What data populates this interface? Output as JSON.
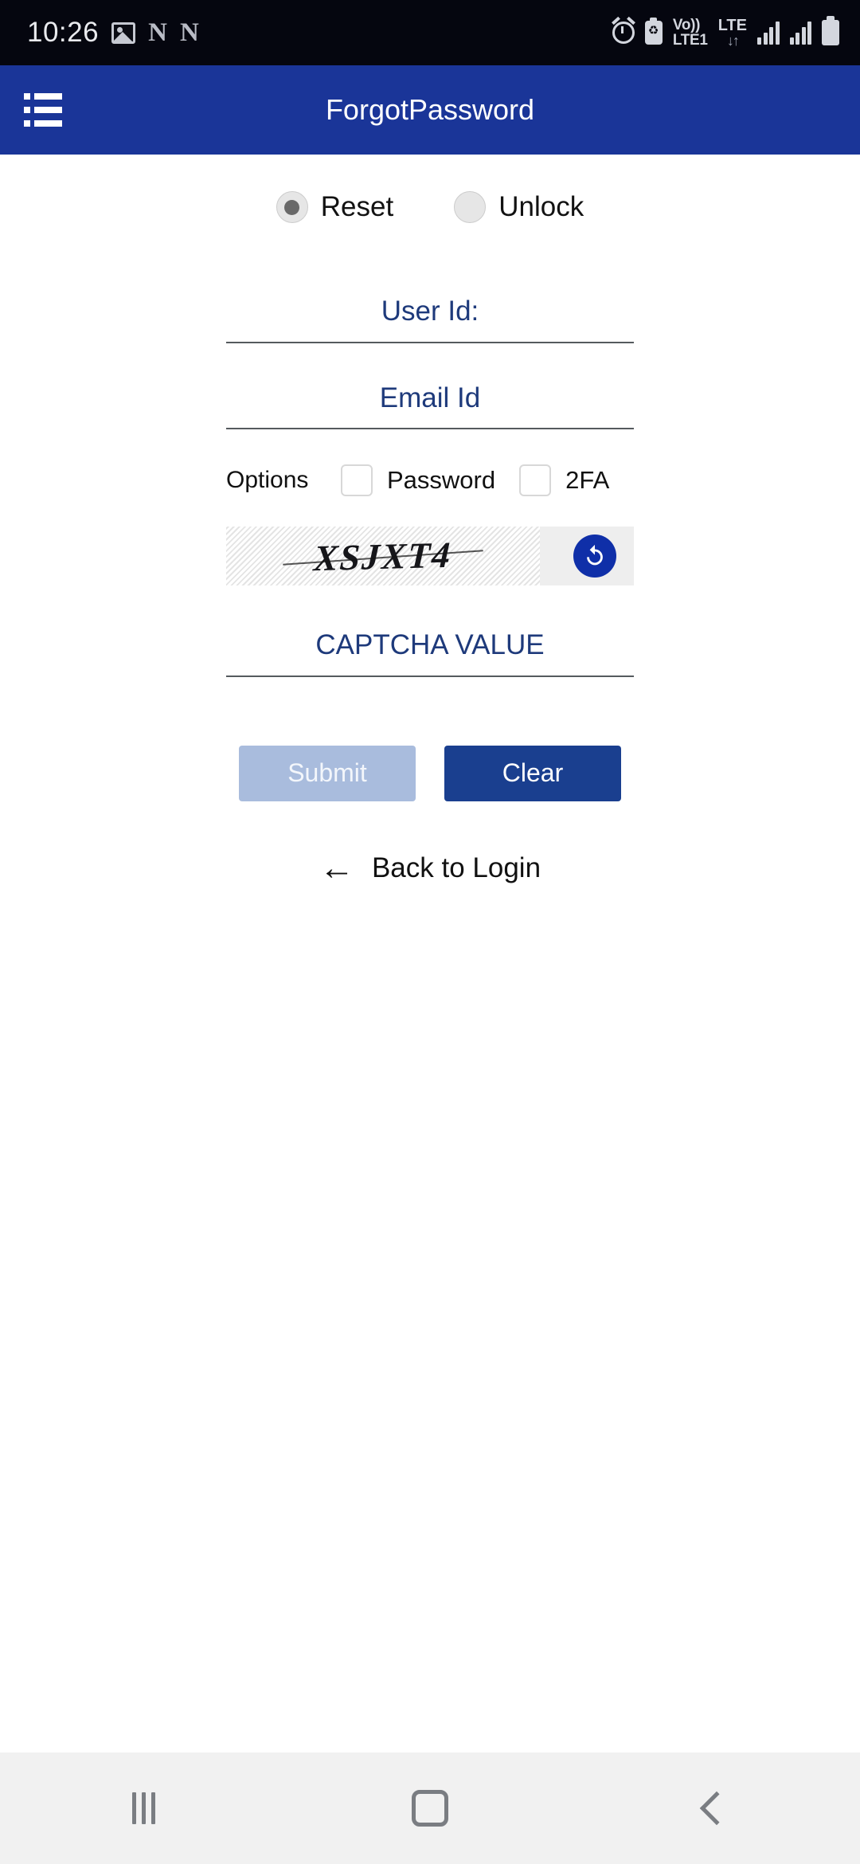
{
  "status_bar": {
    "time": "10:26",
    "left_icons": [
      {
        "name": "photo-icon",
        "glyph": "image"
      },
      {
        "name": "notification-n-icon-1",
        "glyph": "N"
      },
      {
        "name": "notification-n-icon-2",
        "glyph": "N"
      }
    ],
    "right_icons": [
      {
        "name": "alarm-icon"
      },
      {
        "name": "battery-saver-icon",
        "glyph": "♻"
      },
      {
        "name": "volte-icon"
      },
      {
        "name": "lte-data-icon"
      },
      {
        "name": "signal-sim1-icon"
      },
      {
        "name": "signal-sim2-icon"
      },
      {
        "name": "battery-icon"
      }
    ],
    "volte_line1": "Vo))",
    "volte_line2": "LTE1",
    "lte_label": "LTE",
    "lte_arrows": "↓↑",
    "background": "#05060f",
    "foreground": "#d3d6de"
  },
  "app_bar": {
    "title": "ForgotPassword",
    "menu_icon": "list-menu-icon",
    "background": "#1a3598",
    "text_color": "#ffffff"
  },
  "mode_selector": {
    "options": [
      {
        "label": "Reset",
        "selected": true
      },
      {
        "label": "Unlock",
        "selected": false
      }
    ]
  },
  "form": {
    "user_id": {
      "placeholder": "User Id:",
      "value": ""
    },
    "email_id": {
      "placeholder": "Email Id",
      "value": ""
    },
    "options_label": "Options",
    "checkboxes": [
      {
        "label": "Password",
        "checked": false
      },
      {
        "label": "2FA",
        "checked": false
      }
    ],
    "captcha": {
      "value": "XSJXT4",
      "refresh_icon": "refresh-icon",
      "refresh_color": "#0f2fa8"
    },
    "captcha_input": {
      "placeholder": "CAPTCHA VALUE",
      "value": ""
    }
  },
  "buttons": {
    "submit": {
      "label": "Submit",
      "enabled": false,
      "color": "#a9bcdd"
    },
    "clear": {
      "label": "Clear",
      "enabled": true,
      "color": "#1a3f8f"
    }
  },
  "back_link": {
    "label": "Back to Login",
    "icon": "arrow-left-icon"
  },
  "nav_bar": {
    "recent_label": "recent-apps",
    "home_label": "home",
    "back_label": "back",
    "background": "#f1f1f1"
  },
  "colors": {
    "primary": "#1a3598",
    "field_text": "#1e3a7b",
    "field_underline": "#555a5e"
  }
}
